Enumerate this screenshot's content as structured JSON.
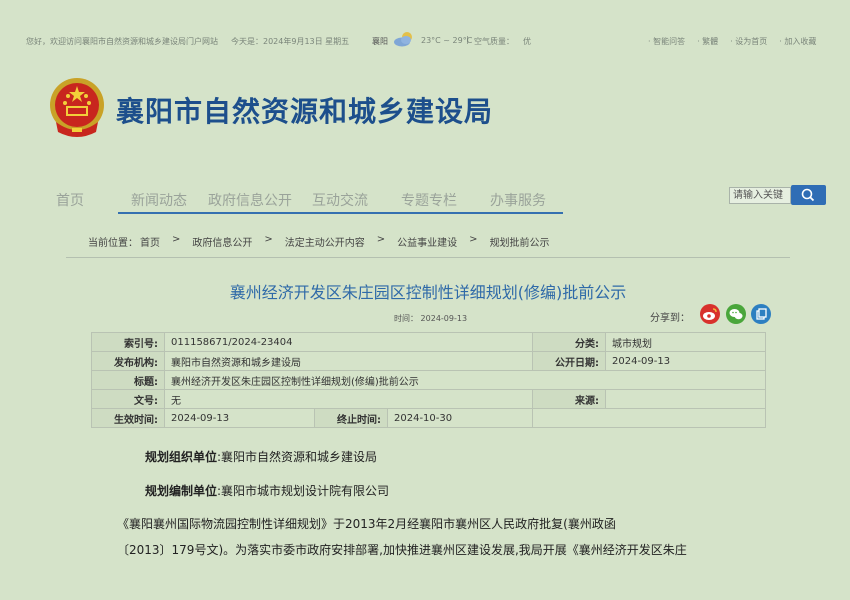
{
  "topbar": {
    "welcome": "您好，欢迎访问襄阳市自然资源和城乡建设局门户网站",
    "date": "今天是：2024年9月13日 星期五",
    "city": "襄阳",
    "temp": "23°C ~ 29°C",
    "aqi_label": "空气质量：",
    "aqi_value": "优",
    "links": [
      "· 智能问答",
      "· 繁體",
      "· 设为首页",
      "· 加入收藏"
    ]
  },
  "header": {
    "title": "襄阳市自然资源和城乡建设局"
  },
  "nav": {
    "items": [
      "首页",
      "新闻动态",
      "政府信息公开",
      "互动交流",
      "专题专栏",
      "办事服务"
    ]
  },
  "search": {
    "placeholder": "请输入关键"
  },
  "breadcrumb": {
    "label": "当前位置：",
    "items": [
      "首页",
      "政府信息公开",
      "法定主动公开内容",
      "公益事业建设",
      "规划批前公示"
    ],
    "sep": ">"
  },
  "article": {
    "title": "襄州经济开发区朱庄园区控制性详细规划(修编)批前公示",
    "time_label": "时间：",
    "time": "2024-09-13",
    "share_label": "分享到："
  },
  "info": {
    "index_label": "索引号:",
    "index": "011158671/2024-23404",
    "category_label": "分类:",
    "category": "城市规划",
    "publisher_label": "发布机构:",
    "publisher": "襄阳市自然资源和城乡建设局",
    "pubdate_label": "公开日期:",
    "pubdate": "2024-09-13",
    "title_label": "标题:",
    "title": "襄州经济开发区朱庄园区控制性详细规划(修编)批前公示",
    "docno_label": "文号:",
    "docno": "无",
    "source_label": "来源:",
    "source": "",
    "effective_label": "生效时间:",
    "effective": "2024-09-13",
    "end_label": "终止时间:",
    "end": "2024-10-30"
  },
  "content": {
    "org_label": "规划组织单位",
    "org": ":襄阳市自然资源和城乡建设局",
    "editor_label": "规划编制单位",
    "editor": ":襄阳市城市规划设计院有限公司",
    "para1_line1": "《襄阳襄州国际物流园控制性详细规划》于2013年2月经襄阳市襄州区人民政府批复(襄州政函",
    "para1_line2": "〔2013〕179号文)。为落实市委市政府安排部署,加快推进襄州区建设发展,我局开展《襄州经济开发区朱庄"
  },
  "colors": {
    "background": "#d5e3c9",
    "brand": "#1d4f8c",
    "title_blue": "#2f6aa8",
    "nav_line": "#3570b0"
  },
  "icons": [
    "cloud-icon",
    "emblem-icon",
    "search-icon",
    "weibo-icon",
    "wechat-icon",
    "copy-icon"
  ]
}
